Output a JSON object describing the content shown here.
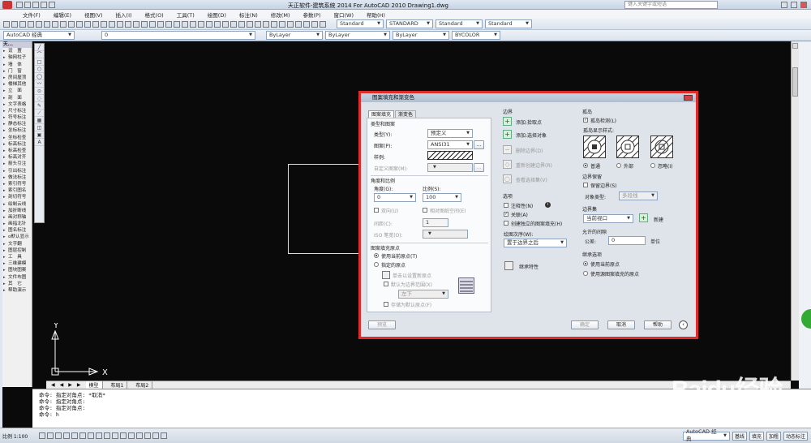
{
  "window": {
    "title": "天正软件-建筑系统 2014  For AutoCAD 2010    Drawing1.dwg",
    "search_placeholder": "键入关键字或短语"
  },
  "menu": [
    "文件(F)",
    "编辑(E)",
    "视图(V)",
    "插入(I)",
    "格式(O)",
    "工具(T)",
    "绘图(D)",
    "标注(N)",
    "修改(M)",
    "参数(P)",
    "窗口(W)",
    "帮助(H)"
  ],
  "toolbar1": {
    "text_style": "Standard",
    "dim_style": "STANDARD",
    "table_style": "Standard",
    "mleader_style": "Standard"
  },
  "toolbar2": {
    "workspace": "AutoCAD 经典",
    "layer": "0",
    "color": "ByLayer",
    "linetype": "ByLayer",
    "lineweight": "ByLayer",
    "plotstyle": "BYCOLOR"
  },
  "tianzheng_panel": {
    "header": "天...",
    "items": [
      "设　置",
      "轴网柱子",
      "墙　体",
      "门　窗",
      "房间屋顶",
      "楼梯其他",
      "立　面",
      "剖　面",
      "文字表格",
      "尺寸标注",
      "符号标注",
      "静态标注",
      "坐标标注",
      "坐标检查",
      "标高标注",
      "标高检查",
      "标高对齐",
      "箭头引注",
      "引出标注",
      "做法标注",
      "索引符号",
      "索引图名",
      "剖切符号",
      "绘制云线",
      "加折断线",
      "画对称轴",
      "画指北针",
      "图名标注",
      "o默认显示",
      "文字翻",
      "图层控制",
      "工　具",
      "三维建模",
      "图块图案",
      "文件布图",
      "其　它",
      "帮助演示"
    ]
  },
  "tabs": [
    "模型",
    "布局1",
    "布局2"
  ],
  "command_lines": [
    "命令: 指定对角点: *取消*",
    "命令: 指定对角点:",
    "命令: 指定对角点:",
    "命令: h"
  ],
  "statusbar": {
    "scale": "比例 1:100",
    "workspace": "AutoCAD 经典",
    "right_buttons": [
      "基线",
      "填充",
      "加粗",
      "动态标注"
    ]
  },
  "ucs": {
    "x_label": "X",
    "y_label": "Y"
  },
  "watermark": {
    "brand": "Baidu经验",
    "url": "jingyan.baidu.com"
  },
  "dialog": {
    "title": "图案填充和渐变色",
    "tabs": [
      "图案填充",
      "渐变色"
    ],
    "type_and_pattern": {
      "group": "类型和图案",
      "type_label": "类型(Y):",
      "type_value": "预定义",
      "pattern_label": "图案(P):",
      "pattern_value": "ANSI31",
      "swatch_label": "样例:",
      "custom_label": "自定义图案(M):"
    },
    "angle_scale": {
      "group": "角度和比例",
      "angle_label": "角度(G):",
      "angle_value": "0",
      "scale_label": "比例(S):",
      "scale_value": "100",
      "double_label": "双向(U)",
      "relative_label": "相对图纸空间(E)",
      "spacing_label": "间距(C):",
      "spacing_value": "1",
      "iso_label": "ISO 笔宽(O):"
    },
    "origin": {
      "group": "图案填充原点",
      "use_current": "使用当前原点(T)",
      "specified": "指定的原点",
      "click_set": "单击以设置新原点",
      "default_boundary": "默认为边界范围(X)",
      "position": "左下",
      "store_default": "存储为默认原点(F)"
    },
    "boundaries": {
      "group": "边界",
      "add_pick": "添加:拾取点",
      "add_select": "添加:选择对象",
      "remove": "删除边界(D)",
      "recreate": "重新创建边界(R)",
      "view_sel": "查看选择集(V)"
    },
    "options": {
      "group": "选项",
      "annotative": "注释性(N)",
      "associative": "关联(A)",
      "separate": "创建独立的图案填充(H)",
      "draw_order_label": "绘图次序(W):",
      "draw_order": "置于边界之后",
      "inherit": "继承特性"
    },
    "islands": {
      "group": "孤岛",
      "detect": "孤岛检测(L)",
      "style_label": "孤岛显示样式:",
      "styles": [
        "普通",
        "外部",
        "忽略(I)"
      ]
    },
    "boundary_retention": {
      "group": "边界保留",
      "retain": "保留边界(S)",
      "obj_type_label": "对象类型:",
      "obj_type": "多段线"
    },
    "boundary_set": {
      "group": "边界集",
      "value": "当前视口",
      "new": "新建"
    },
    "gap": {
      "group": "允许的间隙",
      "tol_label": "公差:",
      "tol_value": "0",
      "unit": "单位"
    },
    "inherit_opts": {
      "group": "继承选项",
      "use_current": "使用当前原点",
      "use_source": "使用源图案填充的原点"
    },
    "buttons": {
      "preview": "预览",
      "ok": "确定",
      "cancel": "取消",
      "help": "帮助"
    }
  }
}
